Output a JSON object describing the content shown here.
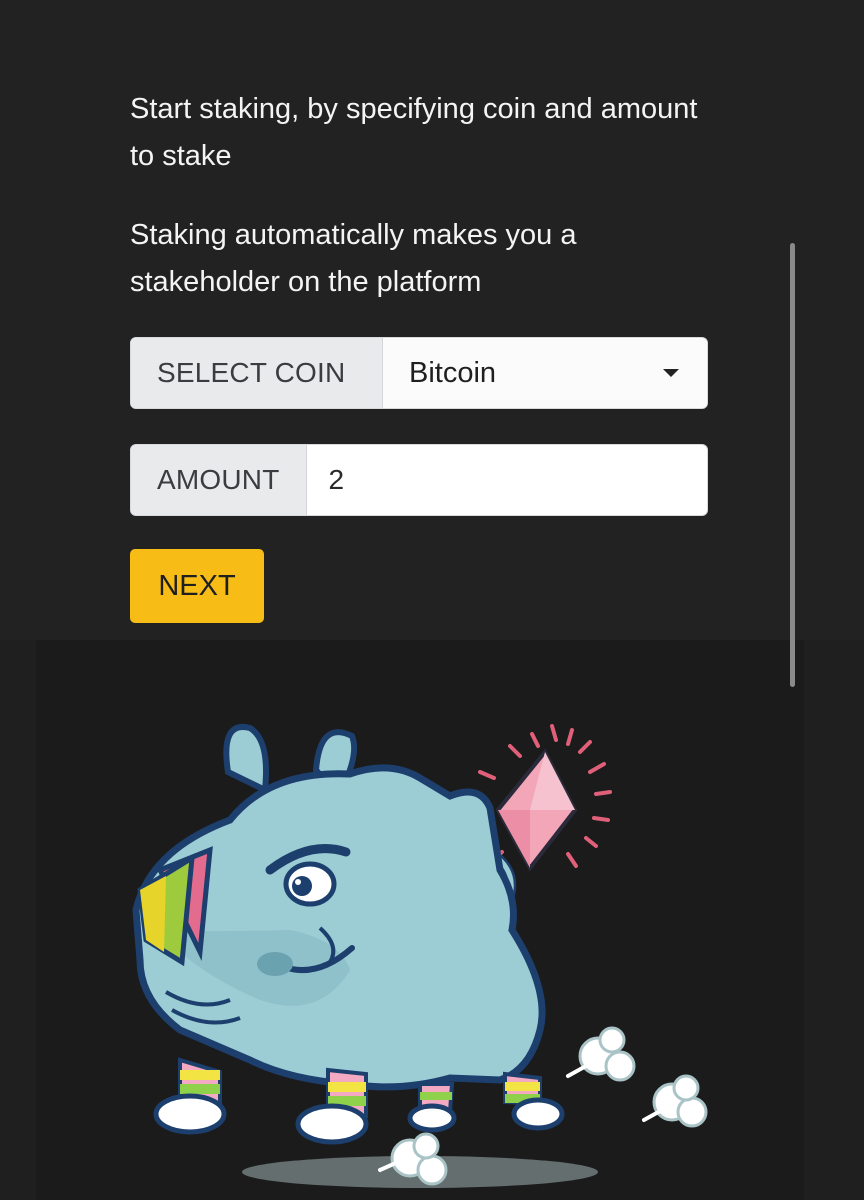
{
  "intro": {
    "line1": "Start staking, by specifying coin and amount to stake",
    "line2": "Staking automatically makes you a stakeholder on the platform"
  },
  "coin_select": {
    "label": "SELECT COIN",
    "selected": "Bitcoin"
  },
  "amount": {
    "label": "AMOUNT",
    "value": "2"
  },
  "next_button": {
    "label": "NEXT"
  },
  "colors": {
    "background": "#222222",
    "accent": "#f7bd16",
    "addon": "#e9eaec",
    "rhino_body": "#9cccd4",
    "rhino_outline": "#1d3f6e"
  },
  "illustration": {
    "icon": "rhino-mascot-icon"
  }
}
